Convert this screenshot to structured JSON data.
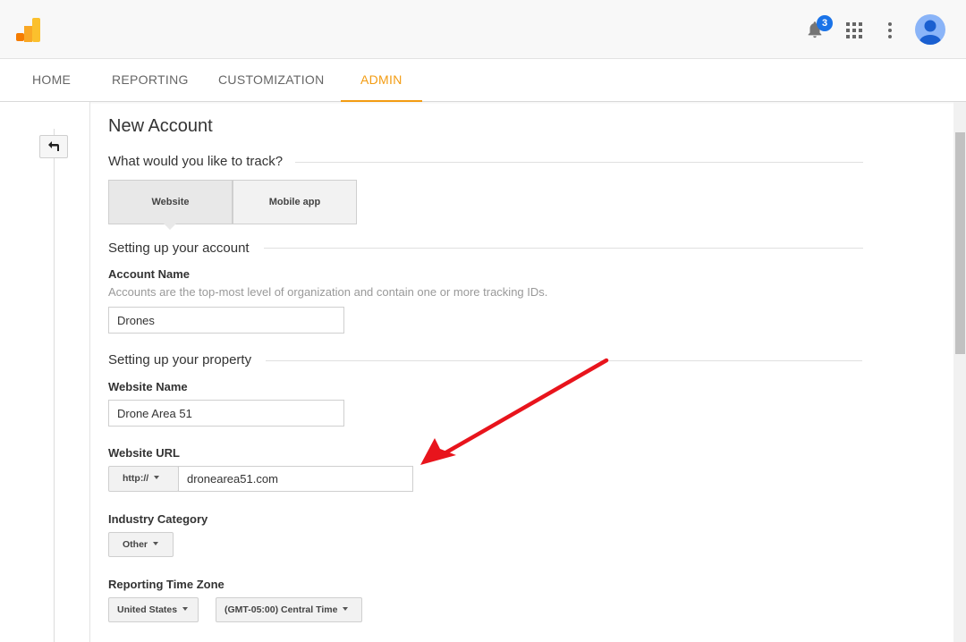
{
  "header": {
    "notification_count": "3"
  },
  "nav": {
    "tabs": [
      {
        "label": "HOME"
      },
      {
        "label": "REPORTING"
      },
      {
        "label": "CUSTOMIZATION"
      },
      {
        "label": "ADMIN"
      }
    ],
    "active_tab": "ADMIN"
  },
  "form": {
    "title": "New Account",
    "track_question": "What would you like to track?",
    "track_options": [
      "Website",
      "Mobile app"
    ],
    "track_selected": "Website",
    "account_section": "Setting up your account",
    "account_name_label": "Account Name",
    "account_name_help": "Accounts are the top-most level of organization and contain one or more tracking IDs.",
    "account_name_value": "Drones",
    "property_section": "Setting up your property",
    "website_name_label": "Website Name",
    "website_name_value": "Drone Area 51",
    "website_url_label": "Website URL",
    "protocol_value": "http://",
    "website_url_value": "dronearea51.com",
    "industry_label": "Industry Category",
    "industry_value": "Other",
    "timezone_label": "Reporting Time Zone",
    "timezone_country": "United States",
    "timezone_value": "(GMT-05:00) Central Time"
  },
  "annotation": {
    "arrow_color": "#e8141c"
  },
  "colors": {
    "accent": "#f39c12",
    "badge": "#1a73e8"
  },
  "icons": {
    "logo": "analytics-logo-icon",
    "bell": "bell-icon",
    "apps": "apps-grid-icon",
    "more": "more-vert-icon",
    "avatar": "account-avatar-icon",
    "back": "back-arrow-icon"
  }
}
